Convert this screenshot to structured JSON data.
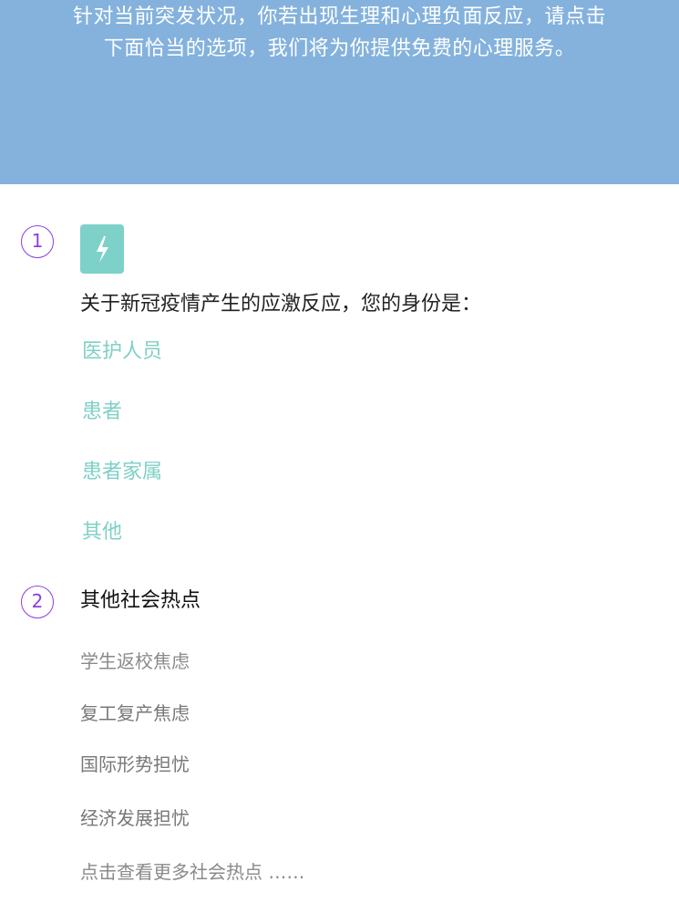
{
  "banner": {
    "line1": "针对当前突发状况，你若出现生理和心理负面反应，请点击",
    "line2": "下面恰当的选项，我们将为你提供免费的心理服务。",
    "bg_color": "#84b2dd"
  },
  "step1": {
    "number": "1",
    "icon": "lightning-bolt-icon",
    "icon_color": "#7dd1c9",
    "question": "关于新冠疫情产生的应激反应，您的身份是：",
    "options": [
      "医护人员",
      "患者",
      "患者家属",
      "其他"
    ],
    "option_color": "#7fd0c6"
  },
  "step2": {
    "number": "2",
    "title": "其他社会热点",
    "items": [
      "学生返校焦虑",
      "复工复产焦虑",
      "国际形势担忧",
      "经济发展担忧"
    ],
    "more": "点击查看更多社会热点 ……"
  },
  "accent_color": "#8a3fe0"
}
